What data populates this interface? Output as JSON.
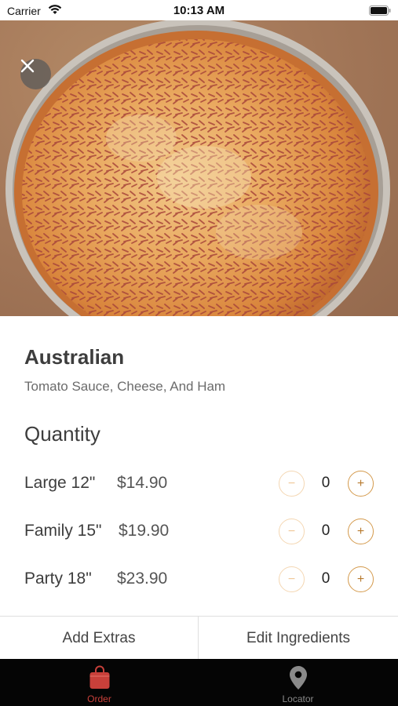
{
  "status_bar": {
    "carrier": "Carrier",
    "time": "10:13 AM",
    "icons": [
      "wifi-icon",
      "battery-icon"
    ]
  },
  "hero": {
    "close_icon": "close-icon"
  },
  "product": {
    "name": "Australian",
    "description": "Tomato Sauce, Cheese, And Ham"
  },
  "quantity": {
    "heading": "Quantity",
    "sizes": [
      {
        "label": "Large 12\"",
        "price": "$14.90",
        "qty": "0"
      },
      {
        "label": "Family 15\"",
        "price": "$19.90",
        "qty": "0"
      },
      {
        "label": "Party 18\"",
        "price": "$23.90",
        "qty": "0"
      }
    ],
    "minus_symbol": "−",
    "plus_symbol": "+"
  },
  "actions": {
    "add_extras": "Add Extras",
    "edit_ingredients": "Edit Ingredients"
  },
  "tabs": [
    {
      "label": "Order",
      "icon": "shopping-bag-icon",
      "active": true
    },
    {
      "label": "Locator",
      "icon": "map-pin-icon",
      "active": false
    }
  ],
  "colors": {
    "accent": "#d49a4c",
    "active_tab": "#c8403a",
    "tab_bar": "#050505"
  }
}
